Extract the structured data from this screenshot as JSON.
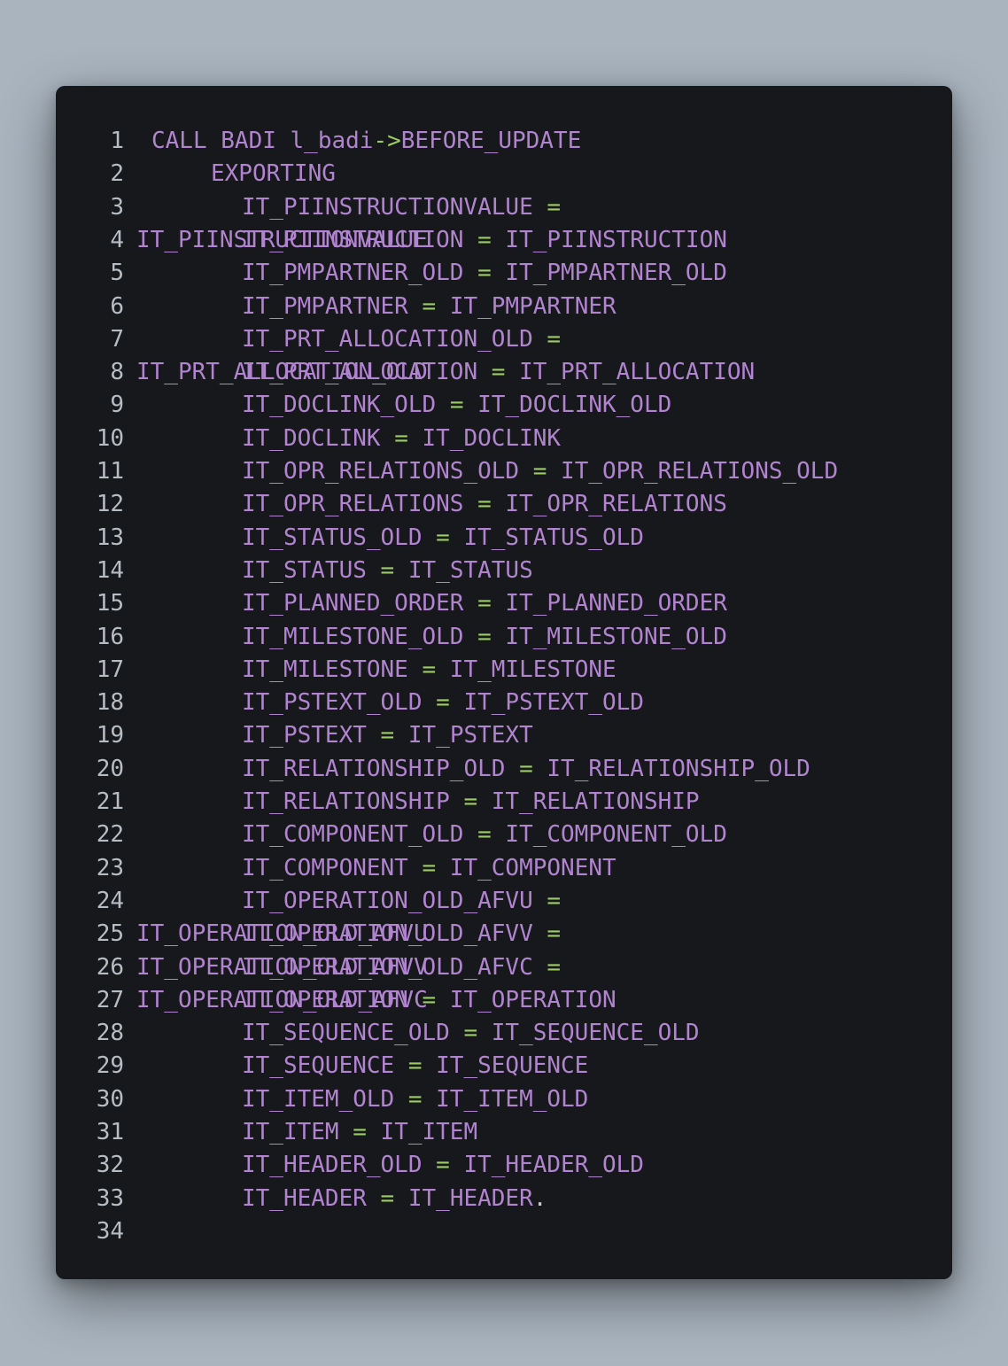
{
  "editor": {
    "lines": [
      {
        "no": "1",
        "indent": 108,
        "tokens": [
          {
            "t": "CALL BADI l_badi",
            "c": "kw"
          },
          {
            "t": "->",
            "c": "op"
          },
          {
            "t": "BEFORE_UPDATE",
            "c": "kw"
          }
        ]
      },
      {
        "no": "2",
        "indent": 175,
        "tokens": [
          {
            "t": "EXPORTING",
            "c": "kw"
          }
        ]
      },
      {
        "no": "3",
        "indent": 210,
        "tokens": [
          {
            "t": "IT_PIINSTRUCTIONVALUE ",
            "c": "kw"
          },
          {
            "t": "=",
            "c": "op"
          }
        ]
      },
      {
        "no": "4",
        "indent": 210,
        "tokens": [
          {
            "t": "IT_PIINSTRUCTION ",
            "c": "kw"
          },
          {
            "t": "=",
            "c": "op"
          },
          {
            "t": " IT_PIINSTRUCTION",
            "c": "kw"
          }
        ],
        "overlay": "IT_PIINSTRUCTIONVALUE"
      },
      {
        "no": "5",
        "indent": 210,
        "tokens": [
          {
            "t": "IT_PMPARTNER_OLD ",
            "c": "kw"
          },
          {
            "t": "=",
            "c": "op"
          },
          {
            "t": " IT_PMPARTNER_OLD",
            "c": "kw"
          }
        ]
      },
      {
        "no": "6",
        "indent": 210,
        "tokens": [
          {
            "t": "IT_PMPARTNER ",
            "c": "kw"
          },
          {
            "t": "=",
            "c": "op"
          },
          {
            "t": " IT_PMPARTNER",
            "c": "kw"
          }
        ]
      },
      {
        "no": "7",
        "indent": 210,
        "tokens": [
          {
            "t": "IT_PRT_ALLOCATION_OLD ",
            "c": "kw"
          },
          {
            "t": "=",
            "c": "op"
          }
        ]
      },
      {
        "no": "8",
        "indent": 210,
        "tokens": [
          {
            "t": "IT_PRT_ALLOCATION ",
            "c": "kw"
          },
          {
            "t": "=",
            "c": "op"
          },
          {
            "t": " IT_PRT_ALLOCATION",
            "c": "kw"
          }
        ],
        "overlay": "IT_PRT_ALLOCATION_OLD"
      },
      {
        "no": "9",
        "indent": 210,
        "tokens": [
          {
            "t": "IT_DOCLINK_OLD ",
            "c": "kw"
          },
          {
            "t": "=",
            "c": "op"
          },
          {
            "t": " IT_DOCLINK_OLD",
            "c": "kw"
          }
        ]
      },
      {
        "no": "10",
        "indent": 210,
        "tokens": [
          {
            "t": "IT_DOCLINK ",
            "c": "kw"
          },
          {
            "t": "=",
            "c": "op"
          },
          {
            "t": " IT_DOCLINK",
            "c": "kw"
          }
        ]
      },
      {
        "no": "11",
        "indent": 210,
        "tokens": [
          {
            "t": "IT_OPR_RELATIONS_OLD ",
            "c": "kw"
          },
          {
            "t": "=",
            "c": "op"
          },
          {
            "t": " IT_OPR_RELATIONS_OLD",
            "c": "kw"
          }
        ]
      },
      {
        "no": "12",
        "indent": 210,
        "tokens": [
          {
            "t": "IT_OPR_RELATIONS ",
            "c": "kw"
          },
          {
            "t": "=",
            "c": "op"
          },
          {
            "t": " IT_OPR_RELATIONS",
            "c": "kw"
          }
        ]
      },
      {
        "no": "13",
        "indent": 210,
        "tokens": [
          {
            "t": "IT_STATUS_OLD ",
            "c": "kw"
          },
          {
            "t": "=",
            "c": "op"
          },
          {
            "t": " IT_STATUS_OLD",
            "c": "kw"
          }
        ]
      },
      {
        "no": "14",
        "indent": 210,
        "tokens": [
          {
            "t": "IT_STATUS ",
            "c": "kw"
          },
          {
            "t": "=",
            "c": "op"
          },
          {
            "t": " IT_STATUS",
            "c": "kw"
          }
        ]
      },
      {
        "no": "15",
        "indent": 210,
        "tokens": [
          {
            "t": "IT_PLANNED_ORDER ",
            "c": "kw"
          },
          {
            "t": "=",
            "c": "op"
          },
          {
            "t": " IT_PLANNED_ORDER",
            "c": "kw"
          }
        ]
      },
      {
        "no": "16",
        "indent": 210,
        "tokens": [
          {
            "t": "IT_MILESTONE_OLD ",
            "c": "kw"
          },
          {
            "t": "=",
            "c": "op"
          },
          {
            "t": " IT_MILESTONE_OLD",
            "c": "kw"
          }
        ]
      },
      {
        "no": "17",
        "indent": 210,
        "tokens": [
          {
            "t": "IT_MILESTONE ",
            "c": "kw"
          },
          {
            "t": "=",
            "c": "op"
          },
          {
            "t": " IT_MILESTONE",
            "c": "kw"
          }
        ]
      },
      {
        "no": "18",
        "indent": 210,
        "tokens": [
          {
            "t": "IT_PSTEXT_OLD ",
            "c": "kw"
          },
          {
            "t": "=",
            "c": "op"
          },
          {
            "t": " IT_PSTEXT_OLD",
            "c": "kw"
          }
        ]
      },
      {
        "no": "19",
        "indent": 210,
        "tokens": [
          {
            "t": "IT_PSTEXT ",
            "c": "kw"
          },
          {
            "t": "=",
            "c": "op"
          },
          {
            "t": " IT_PSTEXT",
            "c": "kw"
          }
        ]
      },
      {
        "no": "20",
        "indent": 210,
        "tokens": [
          {
            "t": "IT_RELATIONSHIP_OLD ",
            "c": "kw"
          },
          {
            "t": "=",
            "c": "op"
          },
          {
            "t": " IT_RELATIONSHIP_OLD",
            "c": "kw"
          }
        ]
      },
      {
        "no": "21",
        "indent": 210,
        "tokens": [
          {
            "t": "IT_RELATIONSHIP ",
            "c": "kw"
          },
          {
            "t": "=",
            "c": "op"
          },
          {
            "t": " IT_RELATIONSHIP",
            "c": "kw"
          }
        ]
      },
      {
        "no": "22",
        "indent": 210,
        "tokens": [
          {
            "t": "IT_COMPONENT_OLD ",
            "c": "kw"
          },
          {
            "t": "=",
            "c": "op"
          },
          {
            "t": " IT_COMPONENT_OLD",
            "c": "kw"
          }
        ]
      },
      {
        "no": "23",
        "indent": 210,
        "tokens": [
          {
            "t": "IT_COMPONENT ",
            "c": "kw"
          },
          {
            "t": "=",
            "c": "op"
          },
          {
            "t": " IT_COMPONENT",
            "c": "kw"
          }
        ]
      },
      {
        "no": "24",
        "indent": 210,
        "tokens": [
          {
            "t": "IT_OPERATION_OLD_AFVU ",
            "c": "kw"
          },
          {
            "t": "=",
            "c": "op"
          }
        ]
      },
      {
        "no": "25",
        "indent": 210,
        "tokens": [
          {
            "t": "IT_OPERATION_OLD_AFVV ",
            "c": "kw"
          },
          {
            "t": "=",
            "c": "op"
          }
        ],
        "overlay": "IT_OPERATION_OLD_AFVU"
      },
      {
        "no": "26",
        "indent": 210,
        "tokens": [
          {
            "t": "IT_OPERATION_OLD_AFVC ",
            "c": "kw"
          },
          {
            "t": "=",
            "c": "op"
          }
        ],
        "overlay": "IT_OPERATION_OLD_AFVV"
      },
      {
        "no": "27",
        "indent": 210,
        "tokens": [
          {
            "t": "IT_OPERATION ",
            "c": "kw"
          },
          {
            "t": "=",
            "c": "op"
          },
          {
            "t": " IT_OPERATION",
            "c": "kw"
          }
        ],
        "overlay": "IT_OPERATION_OLD_AFVC"
      },
      {
        "no": "28",
        "indent": 210,
        "tokens": [
          {
            "t": "IT_SEQUENCE_OLD ",
            "c": "kw"
          },
          {
            "t": "=",
            "c": "op"
          },
          {
            "t": " IT_SEQUENCE_OLD",
            "c": "kw"
          }
        ]
      },
      {
        "no": "29",
        "indent": 210,
        "tokens": [
          {
            "t": "IT_SEQUENCE ",
            "c": "kw"
          },
          {
            "t": "=",
            "c": "op"
          },
          {
            "t": " IT_SEQUENCE",
            "c": "kw"
          }
        ]
      },
      {
        "no": "30",
        "indent": 210,
        "tokens": [
          {
            "t": "IT_ITEM_OLD ",
            "c": "kw"
          },
          {
            "t": "=",
            "c": "op"
          },
          {
            "t": " IT_ITEM_OLD",
            "c": "kw"
          }
        ]
      },
      {
        "no": "31",
        "indent": 210,
        "tokens": [
          {
            "t": "IT_ITEM ",
            "c": "kw"
          },
          {
            "t": "=",
            "c": "op"
          },
          {
            "t": " IT_ITEM",
            "c": "kw"
          }
        ]
      },
      {
        "no": "32",
        "indent": 210,
        "tokens": [
          {
            "t": "IT_HEADER_OLD ",
            "c": "kw"
          },
          {
            "t": "=",
            "c": "op"
          },
          {
            "t": " IT_HEADER_OLD",
            "c": "kw"
          }
        ]
      },
      {
        "no": "33",
        "indent": 210,
        "tokens": [
          {
            "t": "IT_HEADER ",
            "c": "kw"
          },
          {
            "t": "=",
            "c": "op"
          },
          {
            "t": " IT_HEADER",
            "c": "kw"
          },
          {
            "t": ".",
            "c": "pl"
          }
        ]
      },
      {
        "no": "34",
        "indent": 210,
        "tokens": []
      }
    ]
  }
}
